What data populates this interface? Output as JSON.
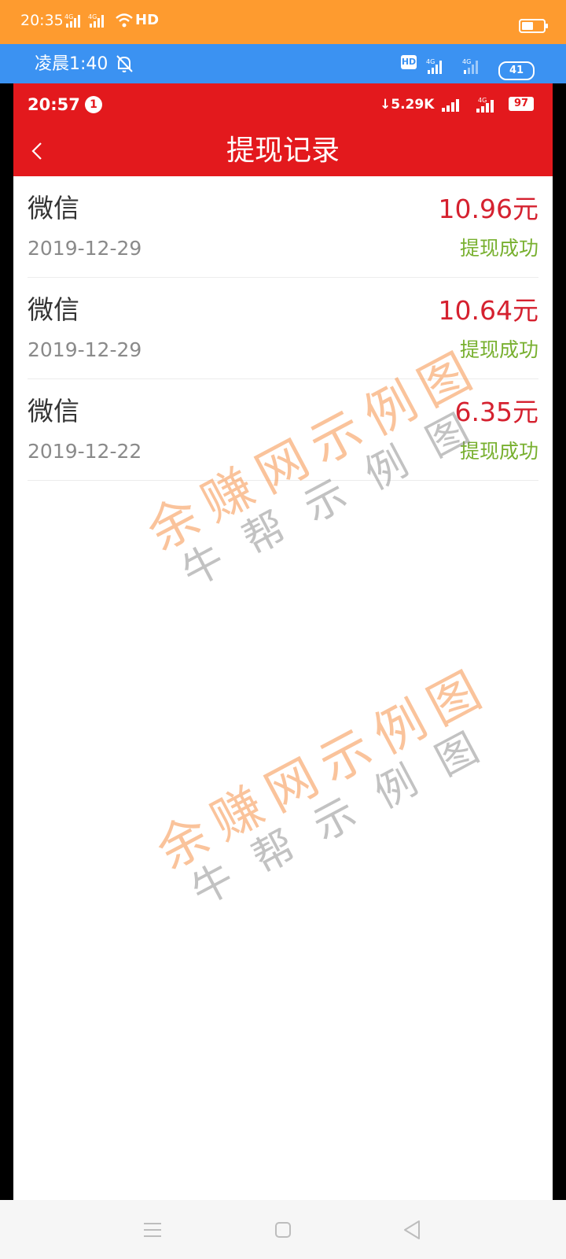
{
  "outer_status_bar": {
    "time": "20:35",
    "hd_label": "HD",
    "color": "#fe9b2f"
  },
  "second_status_bar": {
    "time": "凌晨1:40",
    "hd_label": "HD",
    "battery_level": "41",
    "color": "#3b92f2"
  },
  "app_status_bar": {
    "time": "20:57",
    "notification_badge": "1",
    "network_speed": "↓5.29K",
    "battery_level": "97",
    "color": "#e3191d"
  },
  "header": {
    "title": "提现记录",
    "back_icon": "chevron-left-icon"
  },
  "records": [
    {
      "method": "微信",
      "date": "2019-12-29",
      "amount": "10.96元",
      "status": "提现成功"
    },
    {
      "method": "微信",
      "date": "2019-12-29",
      "amount": "10.64元",
      "status": "提现成功"
    },
    {
      "method": "微信",
      "date": "2019-12-22",
      "amount": "6.35元",
      "status": "提现成功"
    }
  ],
  "watermark": {
    "line1": "余赚网示例图",
    "line2": "牛帮示例图"
  },
  "colors": {
    "amount": "#d5212f",
    "status": "#78b02f",
    "header": "#e3191d"
  },
  "nav": {
    "menu_icon": "menu-icon",
    "home_icon": "home-square-icon",
    "back_icon": "back-triangle-icon"
  }
}
